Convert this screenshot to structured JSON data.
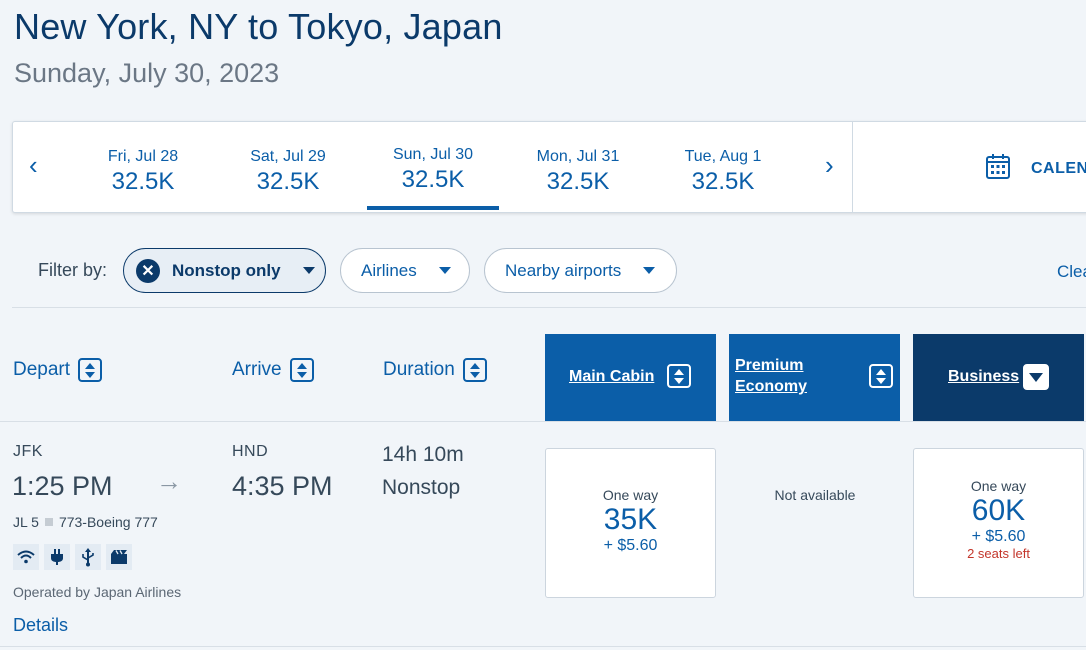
{
  "header": {
    "title": "New York, NY to Tokyo, Japan",
    "date": "Sunday, July 30, 2023"
  },
  "date_strip": {
    "prev": "‹",
    "next": "›",
    "days": [
      {
        "label": "Fri, Jul 28",
        "price": "32.5K",
        "selected": false
      },
      {
        "label": "Sat, Jul 29",
        "price": "32.5K",
        "selected": false
      },
      {
        "label": "Sun, Jul 30",
        "price": "32.5K",
        "selected": true
      },
      {
        "label": "Mon, Jul 31",
        "price": "32.5K",
        "selected": false
      },
      {
        "label": "Tue, Aug 1",
        "price": "32.5K",
        "selected": false
      }
    ],
    "calendar_label": "CALENDAR"
  },
  "filters": {
    "label": "Filter by:",
    "nonstop": "Nonstop only",
    "airlines": "Airlines",
    "nearby": "Nearby airports",
    "clear": "Clear"
  },
  "columns": {
    "depart": "Depart",
    "arrive": "Arrive",
    "duration": "Duration",
    "main_cabin": "Main Cabin",
    "premium_line1": "Premium",
    "premium_line2": "Economy",
    "business": "Business"
  },
  "flight": {
    "origin": "JFK",
    "depart_time": "1:25 PM",
    "destination": "HND",
    "arrive_time": "4:35 PM",
    "duration": "14h 10m",
    "stops": "Nonstop",
    "flight_number": "JL 5",
    "aircraft": "773-Boeing 777",
    "amenities": [
      "wifi-icon",
      "power-outlet-icon",
      "usb-icon",
      "entertainment-icon"
    ],
    "operated_by": "Operated by Japan Airlines",
    "details": "Details"
  },
  "fares": {
    "main_cabin": {
      "label": "One way",
      "miles": "35K",
      "tax": "+ $5.60"
    },
    "premium_economy": {
      "text": "Not available"
    },
    "business": {
      "label": "One way",
      "miles": "60K",
      "tax": "+ $5.60",
      "seats": "2 seats left"
    }
  },
  "colors": {
    "primary": "#0b5ea8",
    "navy": "#0b3a6a",
    "alert": "#c3362b"
  }
}
